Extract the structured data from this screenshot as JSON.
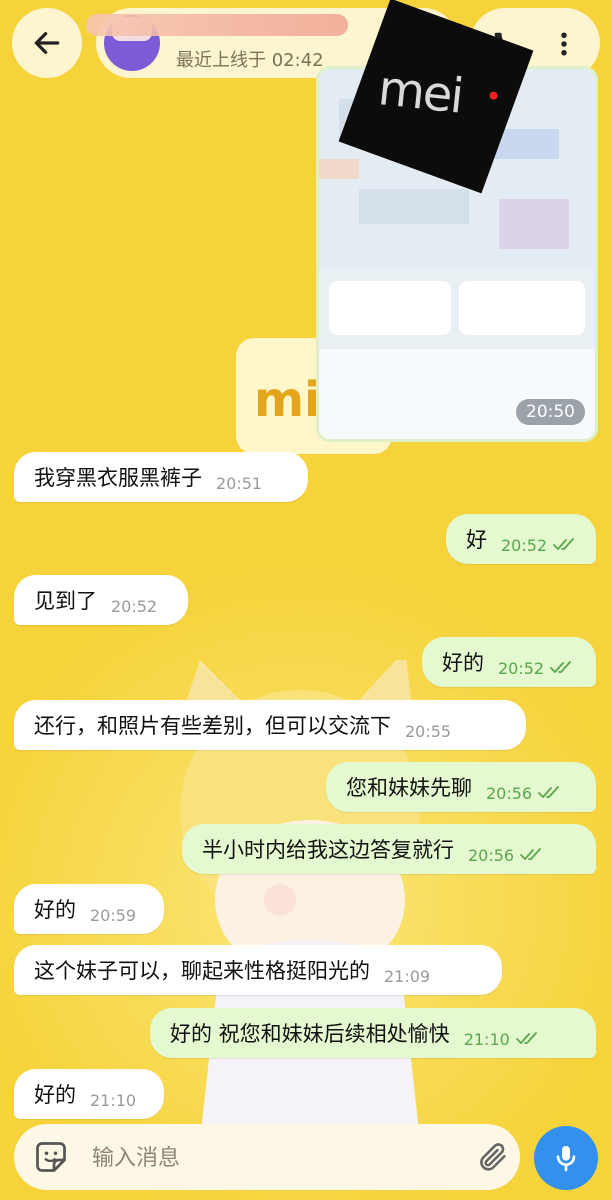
{
  "header": {
    "last_seen": "最近上线于 02:42"
  },
  "map_message": {
    "logo_text": "mei",
    "time": "20:50"
  },
  "messages": [
    {
      "dir": "in",
      "text": "我穿黑衣服黑裤子",
      "time": "20:51"
    },
    {
      "dir": "out",
      "text": "好",
      "time": "20:52"
    },
    {
      "dir": "in",
      "text": "见到了",
      "time": "20:52"
    },
    {
      "dir": "out",
      "text": "好的",
      "time": "20:52"
    },
    {
      "dir": "in",
      "text": "还行，和照片有些差别，但可以交流下",
      "time": "20:55"
    },
    {
      "dir": "out",
      "text": "您和妹妹先聊",
      "time": "20:56"
    },
    {
      "dir": "out",
      "text": "半小时内给我这边答复就行",
      "time": "20:56"
    },
    {
      "dir": "in",
      "text": "好的",
      "time": "20:59"
    },
    {
      "dir": "in",
      "text": "这个妹子可以，聊起来性格挺阳光的",
      "time": "21:09"
    },
    {
      "dir": "out",
      "text": "好的 祝您和妹妹后续相处愉快",
      "time": "21:10"
    },
    {
      "dir": "in",
      "text": "好的",
      "time": "21:10"
    }
  ],
  "wallpaper": {
    "text": "mi"
  },
  "composer": {
    "placeholder": "输入消息"
  },
  "colors": {
    "wallpaper": "#f6d33b",
    "incoming_bubble": "#ffffff",
    "outgoing_bubble": "#e4f9cf",
    "accent": "#3390ec",
    "read_ticks": "#5aa64c"
  }
}
